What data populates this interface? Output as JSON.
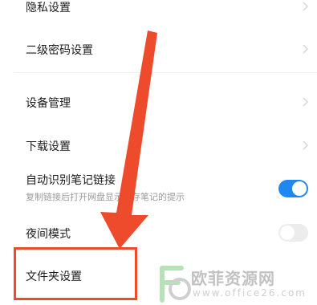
{
  "settings": {
    "privacy": {
      "label": "隐私设置"
    },
    "second_password": {
      "label": "二级密码设置"
    },
    "device_management": {
      "label": "设备管理"
    },
    "download": {
      "label": "下载设置"
    },
    "auto_detect_links": {
      "label": "自动识别笔记链接",
      "description": "复制链接后打开网盘显示保存笔记的提示",
      "enabled": true
    },
    "night_mode": {
      "label": "夜间模式",
      "enabled": false
    },
    "folder": {
      "label": "文件夹设置"
    }
  },
  "colors": {
    "toggle_on": "#1e87f0",
    "toggle_off": "#ececec",
    "annotation_red": "#ee4a2c"
  },
  "watermark": {
    "text": "欧菲资源网",
    "url": "www.office26.com"
  }
}
